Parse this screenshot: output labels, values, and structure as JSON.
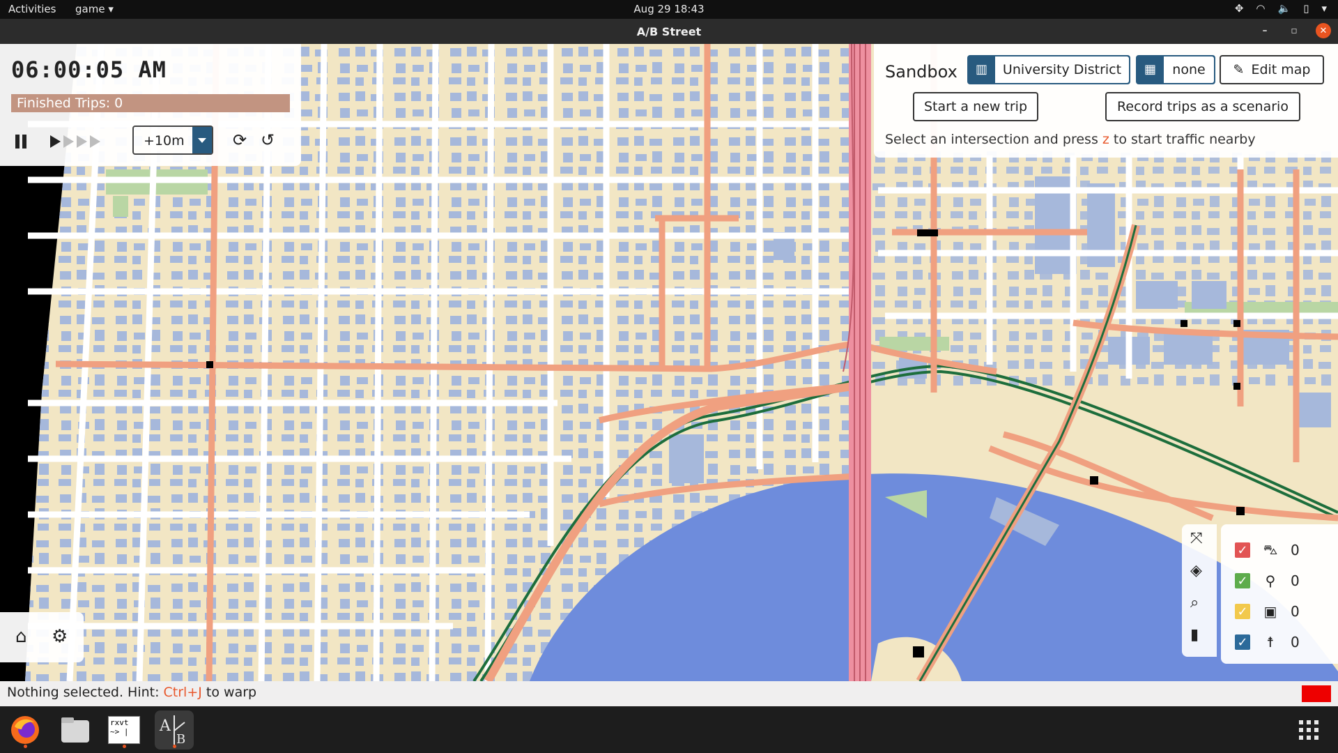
{
  "topbar": {
    "activities": "Activities",
    "app_menu": "game",
    "clock": "Aug 29  18:43"
  },
  "window": {
    "title": "A/B Street",
    "minimize": "–",
    "maximize": "▫",
    "close": "✕"
  },
  "time_panel": {
    "clock": "06:00:05 AM",
    "finished_trips": "Finished Trips: 0",
    "progress": 1,
    "step_value": "+10m"
  },
  "sandbox": {
    "title": "Sandbox",
    "map_name": "University District",
    "scenario": "none",
    "edit_map": "Edit map",
    "start_trip": "Start a new trip",
    "record_trips": "Record trips as a scenario",
    "hint_pre": "Select an intersection and press ",
    "hint_key": "z",
    "hint_post": " to start traffic nearby"
  },
  "legend": {
    "items": [
      {
        "icon": "car-icon",
        "value": "0",
        "color": "#e25454"
      },
      {
        "icon": "bike-icon",
        "value": "0",
        "color": "#5eac4c"
      },
      {
        "icon": "bus-icon",
        "value": "0",
        "color": "#f2c94c"
      },
      {
        "icon": "pedestrian-icon",
        "value": "0",
        "color": "#2c6a9a"
      }
    ]
  },
  "status": {
    "pre": "Nothing selected. Hint: ",
    "key": "Ctrl+J",
    "post": " to warp"
  },
  "dock": {
    "terminal_label": "rxvt",
    "terminal_prompt": "~> |"
  },
  "colors": {
    "ground": "#f2e6c4",
    "building": "#a6b8db",
    "road": "#ffffff",
    "arterial": "#f0a080",
    "highway": "#ee90a0",
    "water": "#6e8cdc",
    "park": "#b9d6a4",
    "rail": "#1d6e3c",
    "panel_blue": "#285a7f",
    "accent": "#e95420"
  }
}
